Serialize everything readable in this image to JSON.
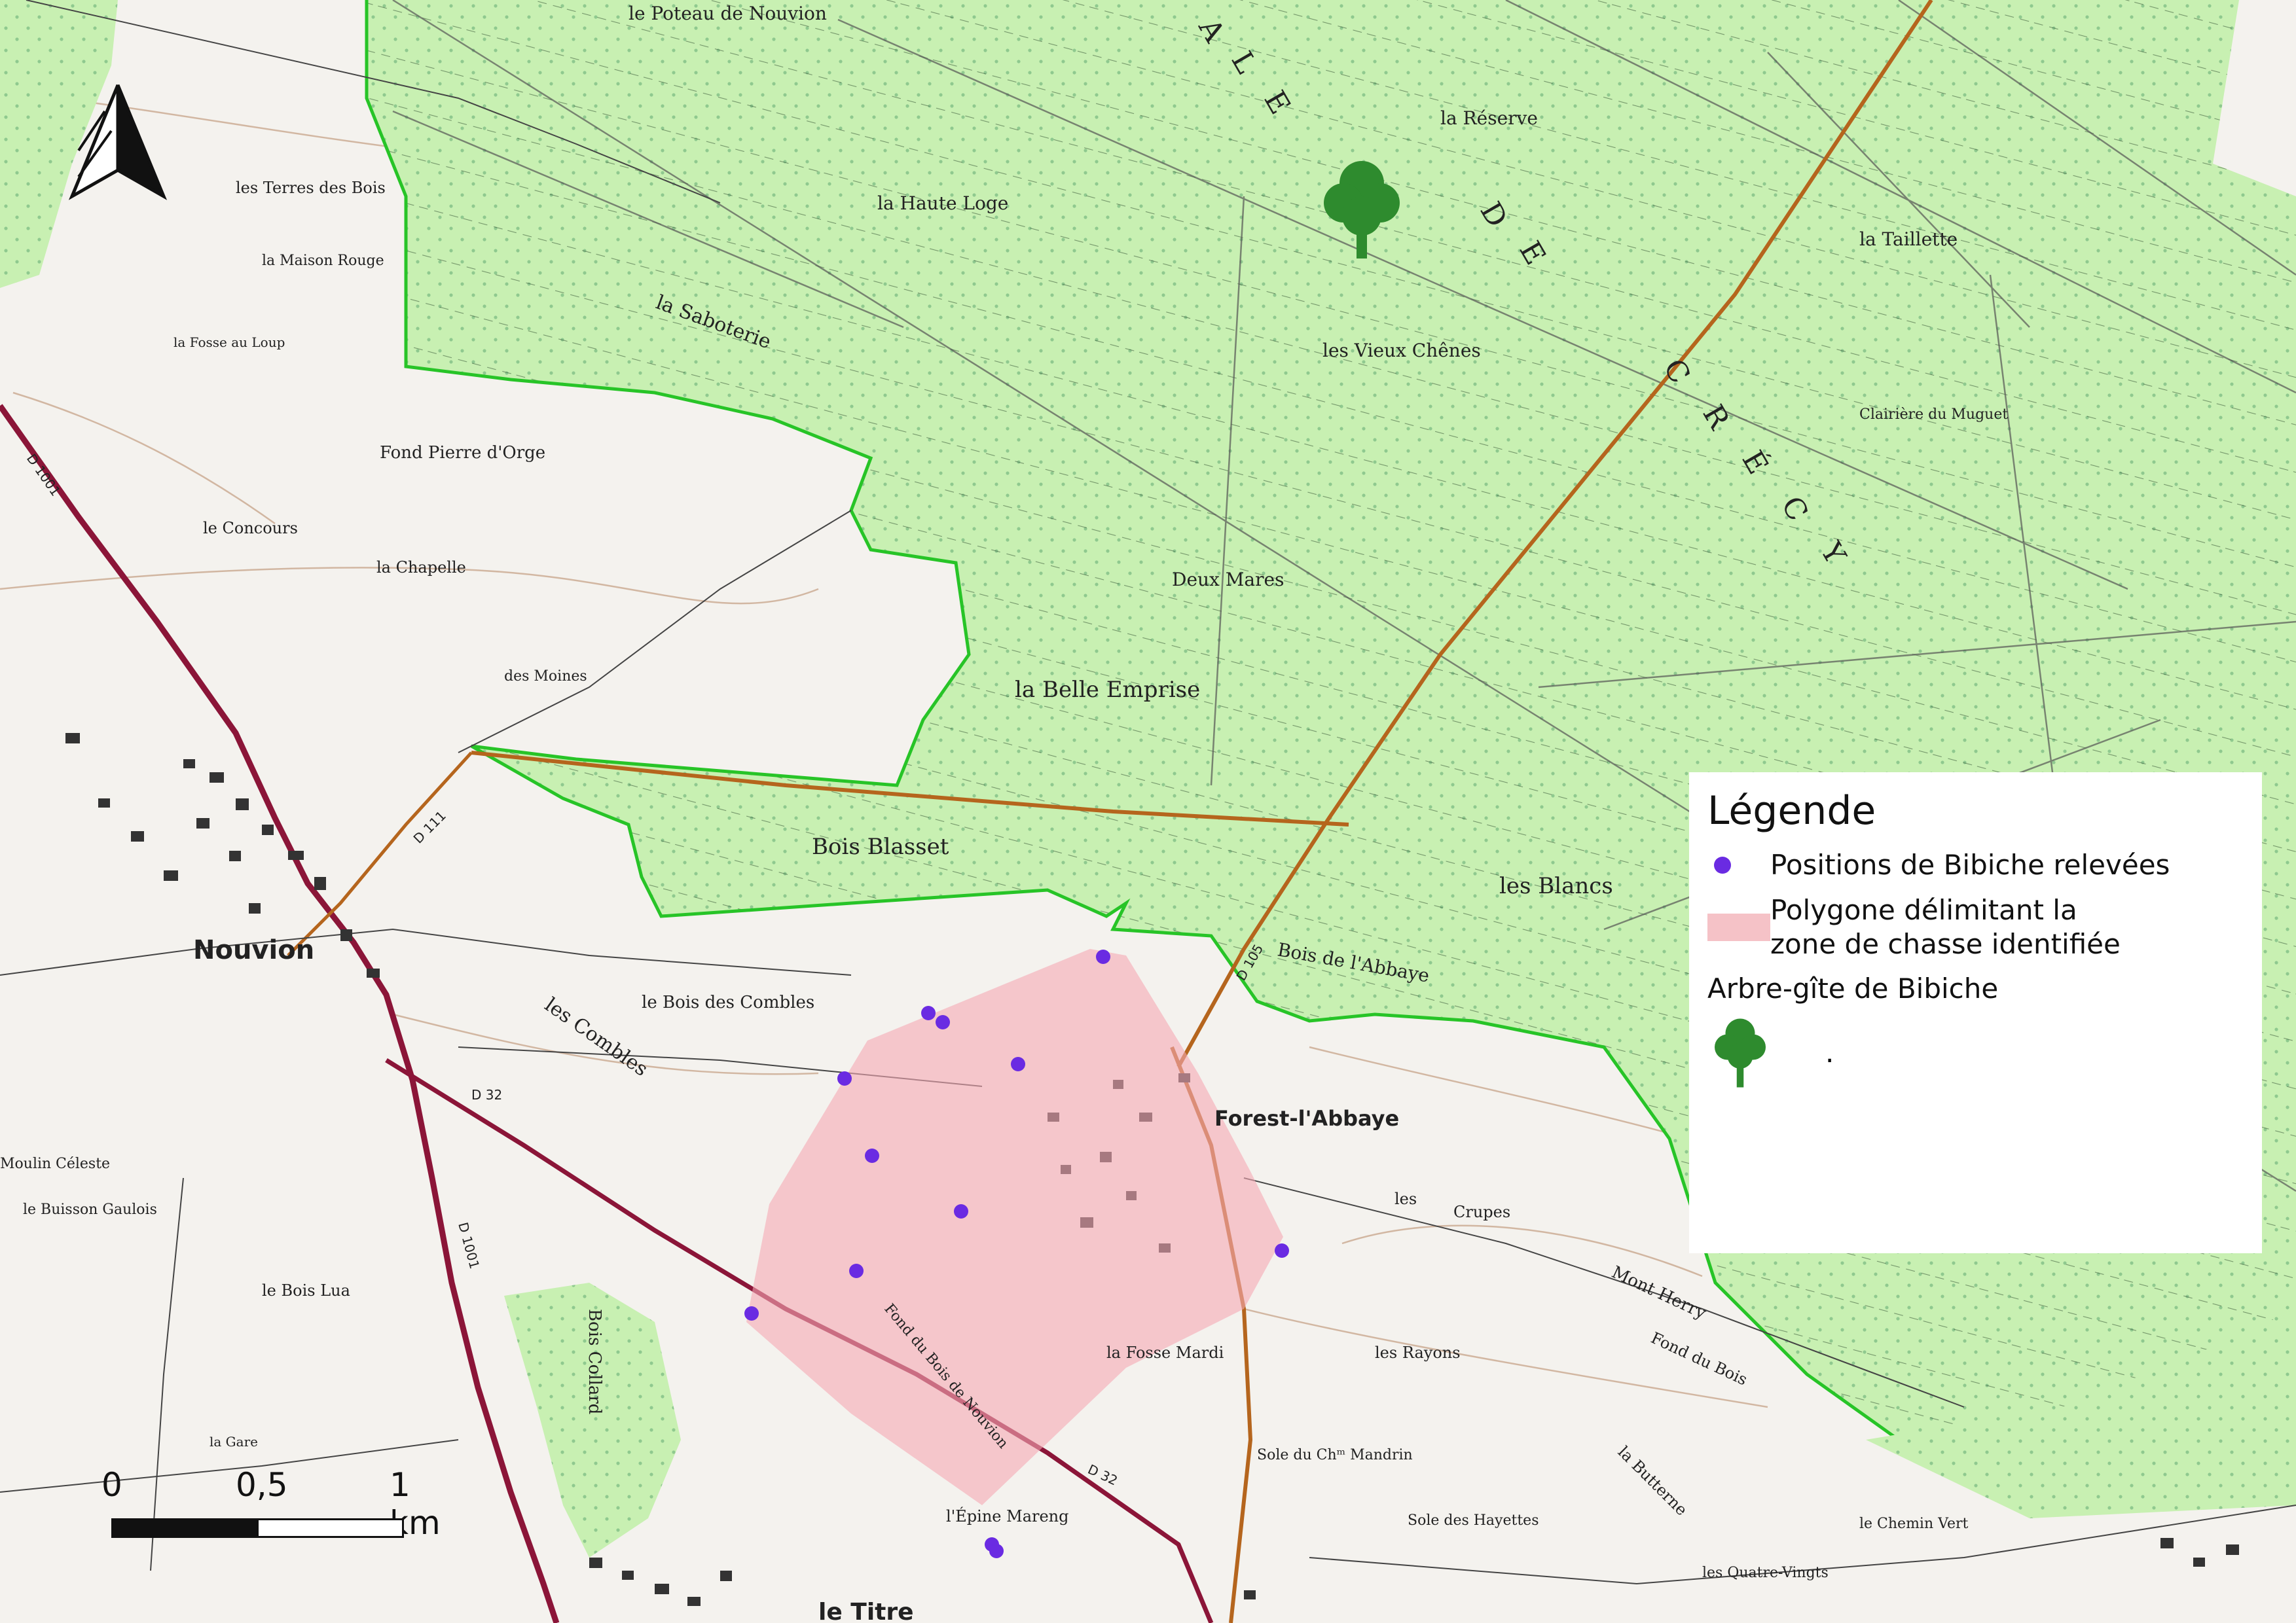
{
  "legend": {
    "title": "Légende",
    "items": [
      {
        "label": "Positions de Bibiche relevées",
        "symbol": "purple-dot",
        "color": "#6a2be2"
      },
      {
        "label": "Polygone délimitant la zone de chasse identifiée",
        "symbol": "pink-polygon",
        "color": "#f5c2c7"
      }
    ],
    "tree_label": "Arbre-gîte de Bibiche",
    "tree_trailer": ".",
    "tree_color": "#2e8b2e"
  },
  "scale": {
    "labels": [
      "0",
      "0,5",
      "1 km"
    ]
  },
  "north_arrow": {
    "icon": "north-arrow-icon"
  },
  "map_labels": {
    "forest_title": "FORÊT DOMANIALE DE CRÉCY",
    "letters_de": "DE",
    "places": [
      "le Poteau de Nouvion",
      "la Réserve",
      "la Haute Loge",
      "la Taillette",
      "la Saboterie",
      "les Vieux Chênes",
      "Clairière du Muguet",
      "Deux Mares",
      "la Belle Emprise",
      "Bois Blasset",
      "les Blancs",
      "Bois de l'Abbaye",
      "Nouvion",
      "le Bois des Combles",
      "Forest-l'Abbaye",
      "les Crupes",
      "les Rayons",
      "la Fosse Mardi",
      "Sole du Chᵐ Mandrin",
      "l'Épine Mareng",
      "le Titre",
      "les Terres des Bois",
      "la Maison Rouge",
      "Fond Pierre d'Orge",
      "le Concours",
      "la Chapelle",
      "des Moines",
      "le Bois Lua",
      "Bois Collard",
      "la Gare",
      "Mont Herry",
      "Fond du Bois",
      "la Butterne",
      "le Chemin Vert",
      "les Quatre-Vingts",
      "Sole des Hayettes",
      "la Fosse au Loup",
      "le Moulin Céleste",
      "le Buisson Gaulois",
      "Combles",
      "Fond du Bois de Nouvion"
    ],
    "roads": [
      "D 1001",
      "D 32",
      "D 111",
      "D 105"
    ]
  }
}
